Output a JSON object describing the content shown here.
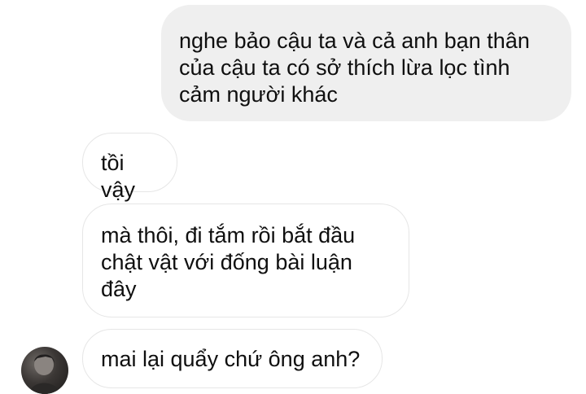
{
  "messages": [
    {
      "direction": "sent",
      "text": "nghe bảo cậu ta và cả anh bạn thân của cậu ta có sở thích lừa lọc tình cảm người khác"
    },
    {
      "direction": "received",
      "text": "tồi vậy"
    },
    {
      "direction": "received",
      "text": "mà thôi, đi tắm rồi bắt đầu chật vật với đống bài luận đây"
    },
    {
      "direction": "received",
      "text": "mai lại quẩy chứ ông anh?"
    }
  ],
  "colors": {
    "sent_bubble": "#efefef",
    "received_border": "#e6e6e6",
    "text": "#0f0f0f"
  }
}
